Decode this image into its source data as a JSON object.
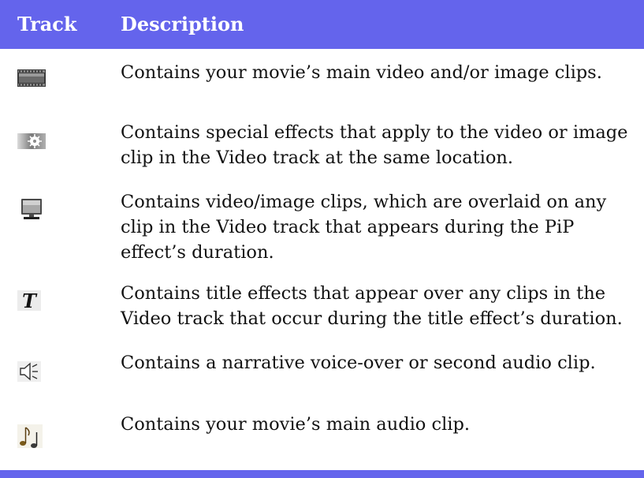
{
  "header": {
    "track": "Track",
    "description": "Description"
  },
  "rows": [
    {
      "icon": "film-strip-icon",
      "description": "Contains your movie’s main video and/or image clips."
    },
    {
      "icon": "effect-icon",
      "description": "Contains special effects that apply to the video or image clip in the Video track at the same location."
    },
    {
      "icon": "pip-monitor-icon",
      "description": "Contains video/image clips, which are overlaid on any clip in the Video track that appears during the PiP effect’s duration."
    },
    {
      "icon": "title-t-icon",
      "description": "Contains title effects that appear over any clips in the Video track that occur during the title effect’s duration."
    },
    {
      "icon": "speaker-icon",
      "description": "Contains a narrative voice-over or second audio clip."
    },
    {
      "icon": "music-note-icon",
      "description": "Contains your movie’s main audio clip."
    }
  ],
  "colors": {
    "header_bg": "#6464ec",
    "header_text": "#ffffff"
  }
}
